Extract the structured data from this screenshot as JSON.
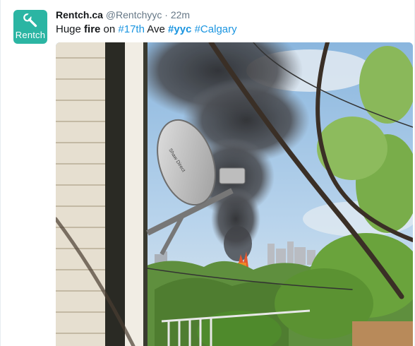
{
  "account": {
    "avatar_text": "Rentch",
    "avatar_icon": "wrench-icon",
    "avatar_color": "#2bb5a3",
    "name": "Rentch.ca",
    "handle": "@Rentchyyc",
    "separator": "·",
    "time": "22m"
  },
  "tweet": {
    "w1": "Huge",
    "w2": "fire",
    "w3": "on",
    "h1": "#17th",
    "w4": "Ave",
    "h2": "#yyc",
    "h3": "#Calgary"
  },
  "photo": {
    "dish_brand": "Shaw Direct",
    "link_color": "#1b95e0"
  }
}
